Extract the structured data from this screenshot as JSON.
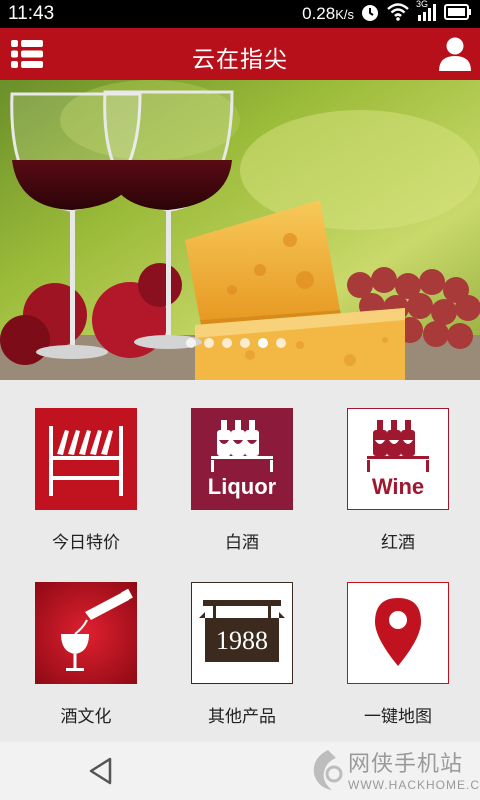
{
  "status_bar": {
    "time": "11:43",
    "data_rate": "0.28",
    "data_rate_unit": "K/s",
    "network_type": "3G"
  },
  "header": {
    "title": "云在指尖",
    "menu_icon": "list-menu-icon",
    "profile_icon": "user-profile-icon",
    "accent_color": "#b8101a"
  },
  "banner": {
    "slide_count": 6,
    "active_slide_index": 4
  },
  "grid": {
    "items": [
      {
        "label": "今日特价",
        "icon": "wine-rack-icon"
      },
      {
        "label": "白酒",
        "icon": "liquor-bottles-icon",
        "tile_text": "Liquor"
      },
      {
        "label": "红酒",
        "icon": "wine-bottles-icon",
        "tile_text": "Wine"
      },
      {
        "label": "酒文化",
        "icon": "wine-pour-icon"
      },
      {
        "label": "其他产品",
        "icon": "hanging-sign-icon",
        "tile_text": "1988"
      },
      {
        "label": "一键地图",
        "icon": "map-pin-icon"
      }
    ]
  },
  "nav_bar": {
    "back_icon": "back-triangle-icon"
  },
  "watermark": {
    "name": "网侠手机站",
    "url": "WWW.HACKHOME.COM"
  }
}
